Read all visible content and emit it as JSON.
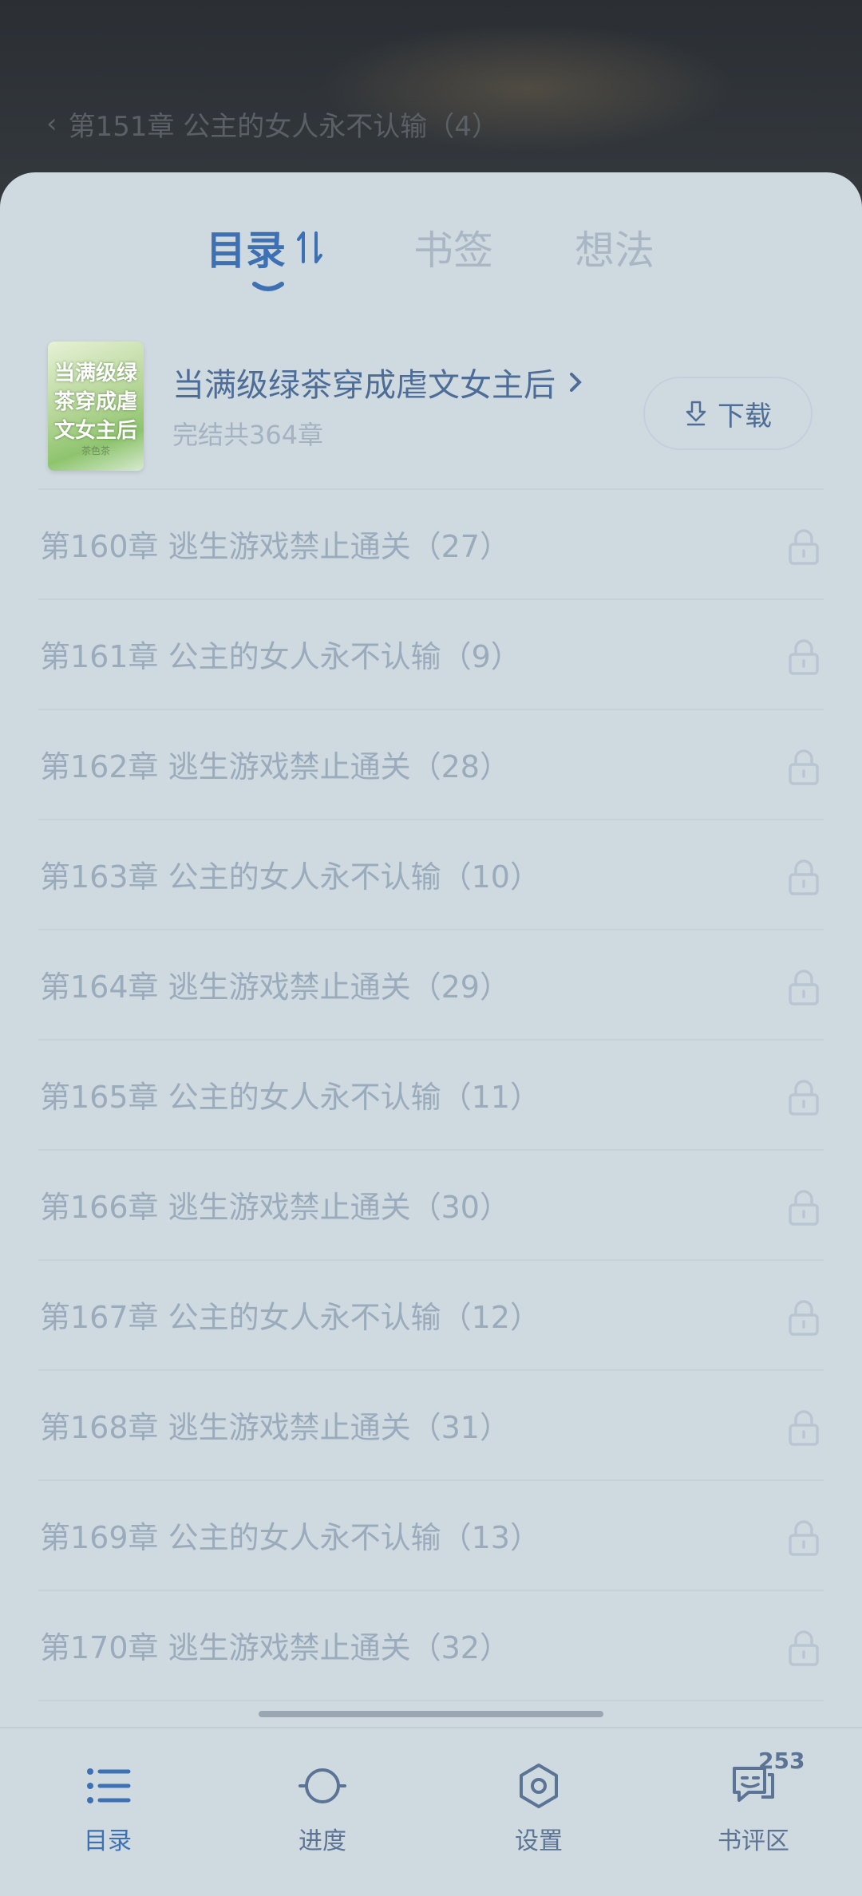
{
  "reader": {
    "current_chapter": "第151章 公主的女人永不认输（4）"
  },
  "tabs": {
    "catalog": "目录",
    "bookmarks": "书签",
    "ideas": "想法"
  },
  "book": {
    "title": "当满级绿茶穿成虐文女主后",
    "meta": "完结共364章",
    "cover_text": "当满级绿茶穿成虐文女主后",
    "cover_author": "茶色茶",
    "download_label": "下载"
  },
  "chapters": [
    {
      "title": "第160章 逃生游戏禁止通关（27）",
      "locked": true
    },
    {
      "title": "第161章 公主的女人永不认输（9）",
      "locked": true
    },
    {
      "title": "第162章 逃生游戏禁止通关（28）",
      "locked": true
    },
    {
      "title": "第163章 公主的女人永不认输（10）",
      "locked": true
    },
    {
      "title": "第164章 逃生游戏禁止通关（29）",
      "locked": true
    },
    {
      "title": "第165章 公主的女人永不认输（11）",
      "locked": true
    },
    {
      "title": "第166章 逃生游戏禁止通关（30）",
      "locked": true
    },
    {
      "title": "第167章 公主的女人永不认输（12）",
      "locked": true
    },
    {
      "title": "第168章 逃生游戏禁止通关（31）",
      "locked": true
    },
    {
      "title": "第169章 公主的女人永不认输（13）",
      "locked": true
    },
    {
      "title": "第170章 逃生游戏禁止通关（32）",
      "locked": true
    }
  ],
  "bottom_nav": {
    "catalog": "目录",
    "progress": "进度",
    "settings": "设置",
    "reviews": "书评区",
    "review_count": "253"
  },
  "colors": {
    "sheet_bg": "#cfd9e0",
    "accent": "#3d71b4",
    "chapter_text": "#9aabbb",
    "inactive_tab": "#a9b7c4"
  }
}
